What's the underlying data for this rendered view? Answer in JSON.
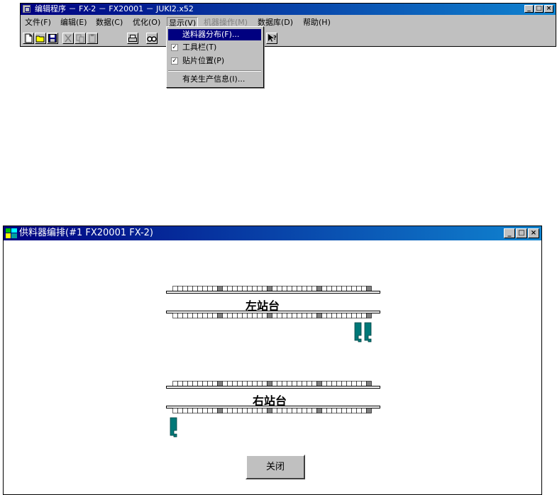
{
  "main_window": {
    "title": "编辑程序 － FX-2 － FX20001 － JUKI2.x52",
    "controls": [
      "_",
      "□",
      "×"
    ],
    "menu": [
      {
        "label": "文件(F)",
        "state": "normal"
      },
      {
        "label": "编辑(E)",
        "state": "normal"
      },
      {
        "label": "数据(C)",
        "state": "normal"
      },
      {
        "label": "优化(O)",
        "state": "normal"
      },
      {
        "label": "显示(V)",
        "state": "active"
      },
      {
        "label": "机器操作(M)",
        "state": "disabled"
      },
      {
        "label": "数据库(D)",
        "state": "normal"
      },
      {
        "label": "帮助(H)",
        "state": "normal"
      }
    ],
    "toolbar_icons": [
      "new-file-icon",
      "open-folder-icon",
      "save-icon",
      "cut-icon",
      "copy-icon",
      "paste-icon",
      "print-icon",
      "find-icon",
      "help-pointer-icon"
    ]
  },
  "view_menu": {
    "items": [
      {
        "label": "送料器分布(F)...",
        "checked": false,
        "highlighted": true
      },
      {
        "label": "工具栏(T)",
        "checked": true,
        "highlighted": false
      },
      {
        "label": "贴片位置(P)",
        "checked": true,
        "highlighted": false
      },
      {
        "label": "有关生产信息(I)...",
        "checked": false,
        "highlighted": false
      }
    ],
    "check_glyph": "✓"
  },
  "feeder_window": {
    "title": "供料器编排(#1 FX20001 FX-2)",
    "controls": [
      "_",
      "□",
      "×"
    ],
    "left_station": "左站台",
    "right_station": "右站台",
    "close_button": "关闭",
    "feeder_color": "#007878"
  }
}
